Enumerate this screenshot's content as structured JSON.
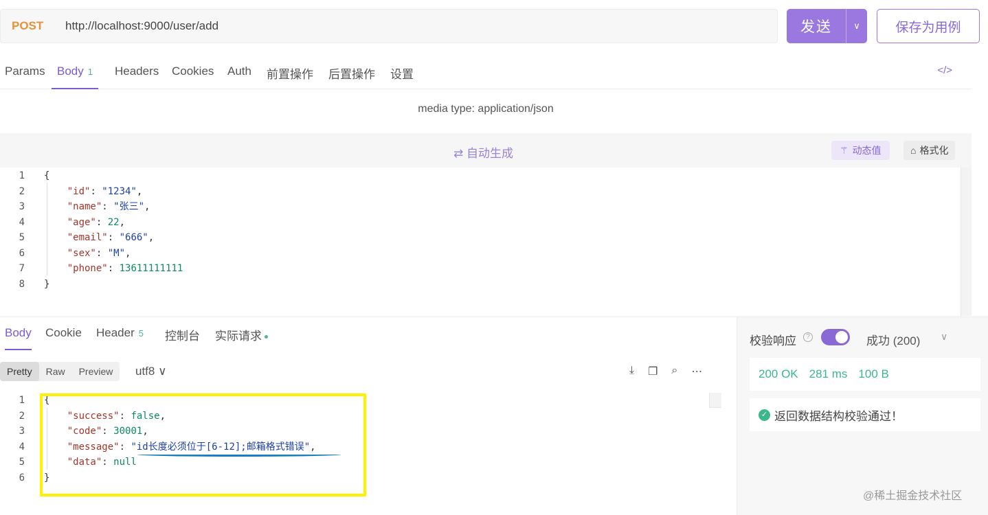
{
  "request": {
    "method": "POST",
    "url": "http://localhost:9000/user/add",
    "send_label": "发送",
    "send_dropdown_icon": "chevron-down-icon",
    "save_label": "保存为用例"
  },
  "req_tabs": {
    "params": "Params",
    "body": "Body",
    "body_count": "1",
    "headers": "Headers",
    "cookies": "Cookies",
    "auth": "Auth",
    "pre_ops": "前置操作",
    "post_ops": "后置操作",
    "settings": "设置",
    "code_icon": "</>"
  },
  "body": {
    "media_type": "media type: application/json",
    "autogen_label": "⇄ 自动生成",
    "dynamic_value_label": "动态值",
    "format_label": "格式化",
    "lines": [
      {
        "num": "1",
        "text": "{"
      },
      {
        "num": "2",
        "key": "\"id\"",
        "value": "\"1234\"",
        "vtype": "s"
      },
      {
        "num": "3",
        "key": "\"name\"",
        "value": "\"张三\"",
        "vtype": "s"
      },
      {
        "num": "4",
        "key": "\"age\"",
        "value": "22",
        "vtype": "n"
      },
      {
        "num": "5",
        "key": "\"email\"",
        "value": "\"666\"",
        "vtype": "s"
      },
      {
        "num": "6",
        "key": "\"sex\"",
        "value": "\"M\"",
        "vtype": "s"
      },
      {
        "num": "7",
        "key": "\"phone\"",
        "value": "13611111111",
        "vtype": "n",
        "last": true
      },
      {
        "num": "8",
        "text": "}"
      }
    ]
  },
  "resp_tabs": {
    "body": "Body",
    "cookie": "Cookie",
    "header": "Header",
    "header_count": "5",
    "console": "控制台",
    "actual_request": "实际请求"
  },
  "resp_view": {
    "pretty": "Pretty",
    "raw": "Raw",
    "preview": "Preview",
    "encoding": "utf8 ∨"
  },
  "response": {
    "lines": [
      {
        "num": "1",
        "text": "{"
      },
      {
        "num": "2",
        "key": "\"success\"",
        "value": "false",
        "vtype": "kw"
      },
      {
        "num": "3",
        "key": "\"code\"",
        "value": "30001",
        "vtype": "n"
      },
      {
        "num": "4",
        "key": "\"message\"",
        "value": "\"id长度必须位于[6-12];邮箱格式错误\"",
        "vtype": "s"
      },
      {
        "num": "5",
        "key": "\"data\"",
        "value": "null",
        "vtype": "kw",
        "last": true
      },
      {
        "num": "6",
        "text": "}"
      }
    ]
  },
  "validation": {
    "title": "校验响应",
    "status": "成功 (200)",
    "status_code": "200 OK",
    "time": "281 ms",
    "size": "100 B",
    "message": "返回数据结构校验通过！",
    "toggle_on": true
  },
  "watermark": "@稀土掘金技术社区"
}
